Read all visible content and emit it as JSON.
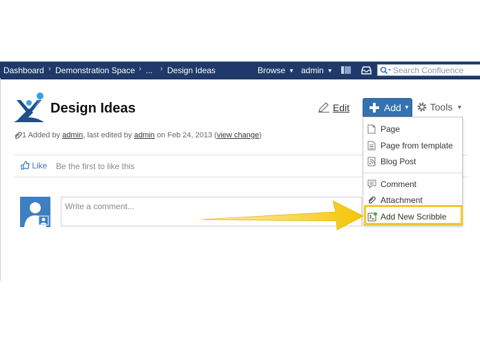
{
  "nav": {
    "breadcrumbs": [
      "Dashboard",
      "Demonstration Space",
      "...",
      "Design Ideas"
    ],
    "browse": "Browse",
    "user": "admin",
    "search_placeholder": "Search Confluence"
  },
  "page": {
    "title": "Design Ideas",
    "attachments_count": "1",
    "meta_added_by": "Added by",
    "meta_creator": "admin",
    "meta_edited_by": ", last edited by",
    "meta_editor": "admin",
    "meta_date": "on Feb 24, 2013",
    "meta_change_link": "view change",
    "like_label": "Like",
    "like_hint": "Be the first to like this",
    "comment_placeholder": "Write a comment..."
  },
  "toolbar": {
    "edit": "Edit",
    "add": "Add",
    "tools": "Tools"
  },
  "add_menu": {
    "items": [
      {
        "label": "Page",
        "icon": "page-icon"
      },
      {
        "label": "Page from template",
        "icon": "template-icon"
      },
      {
        "label": "Blog Post",
        "icon": "blog-icon"
      },
      {
        "label": "Comment",
        "icon": "comment-icon"
      },
      {
        "label": "Attachment",
        "icon": "paperclip-icon"
      },
      {
        "label": "Add New Scribble",
        "icon": "scribble-icon"
      }
    ]
  },
  "colors": {
    "nav_bg": "#1f3a6a",
    "add_button": "#3572b0",
    "link": "#3b73af",
    "highlight": "#f4c820"
  }
}
